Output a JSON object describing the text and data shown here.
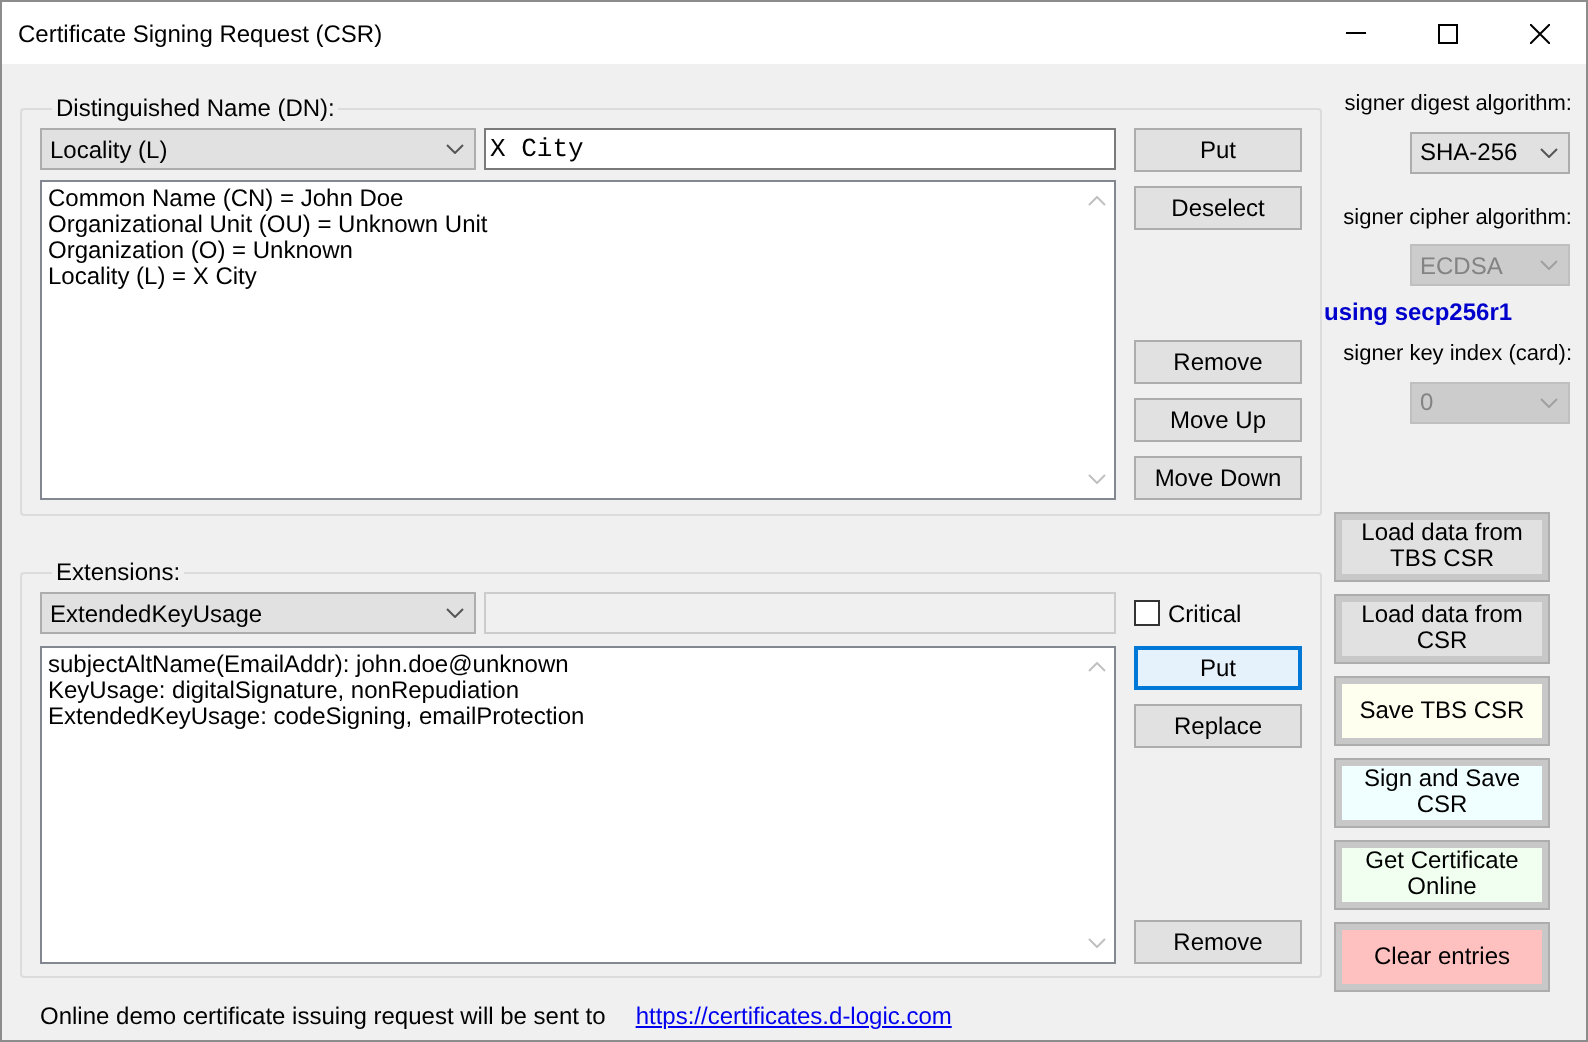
{
  "window": {
    "title": "Certificate Signing Request (CSR)"
  },
  "dn": {
    "title": "Distinguished Name (DN):",
    "attribute": "Locality (L)",
    "value": "X City",
    "entries": [
      "Common Name (CN) = John Doe",
      "Organizational Unit (OU) = Unknown Unit",
      "Organization (O) = Unknown",
      "Locality (L) = X City"
    ],
    "top_buttons": [
      {
        "label": "Put",
        "focused": false
      },
      {
        "label": "Deselect",
        "focused": false
      }
    ],
    "bottom_buttons": [
      {
        "label": "Remove",
        "focused": false
      },
      {
        "label": "Move Up",
        "focused": false
      },
      {
        "label": "Move Down",
        "focused": false
      }
    ]
  },
  "extensions": {
    "title": "Extensions:",
    "type": "ExtendedKeyUsage",
    "value_disabled": true,
    "critical": {
      "label": "Critical",
      "checked": false
    },
    "entries": [
      "subjectAltName(EmailAddr): john.doe@unknown",
      "KeyUsage: digitalSignature, nonRepudiation",
      "ExtendedKeyUsage: codeSigning, emailProtection"
    ],
    "top_buttons": [
      {
        "label": "Put",
        "focused": true
      },
      {
        "label": "Replace",
        "focused": false
      }
    ],
    "bottom_buttons": [
      {
        "label": "Remove",
        "focused": false
      }
    ]
  },
  "signer": {
    "digest": {
      "label": "signer digest algorithm:",
      "value": "SHA-256",
      "disabled": false
    },
    "cipher": {
      "label": "signer cipher algorithm:",
      "value": "ECDSA",
      "disabled": true
    },
    "curve_note": "using secp256r1",
    "key_index": {
      "label": "signer key index (card):",
      "value": "0",
      "disabled": true
    }
  },
  "actions": [
    {
      "label": "Load data from TBS CSR",
      "color": "#e1e1e1"
    },
    {
      "label": "Load data from CSR",
      "color": "#e1e1e1"
    },
    {
      "label": "Save TBS CSR",
      "color": "#fffff0"
    },
    {
      "label": "Sign and Save CSR",
      "color": "#f0ffff"
    },
    {
      "label": "Get Certificate Online",
      "color": "#f0fff0"
    },
    {
      "label": "Clear entries",
      "color": "#ffc0c0"
    }
  ],
  "footer": {
    "text": "Online demo certificate issuing request will be sent to",
    "link": "https://certificates.d-logic.com"
  }
}
